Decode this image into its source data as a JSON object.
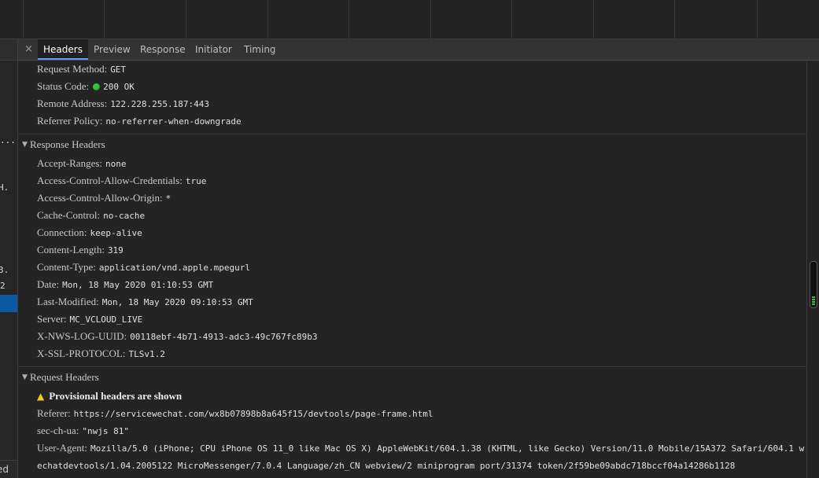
{
  "tabs": [
    {
      "label": "Headers",
      "active": true
    },
    {
      "label": "Preview",
      "active": false
    },
    {
      "label": "Response",
      "active": false
    },
    {
      "label": "Initiator",
      "active": false
    },
    {
      "label": "Timing",
      "active": false
    }
  ],
  "close_glyph": "×",
  "general": {
    "request_method": {
      "key": "Request Method:",
      "value": "GET"
    },
    "status_code": {
      "key": "Status Code:",
      "value": "200 OK",
      "status_color": "#38c43c"
    },
    "remote_address": {
      "key": "Remote Address:",
      "value": "122.228.255.187:443"
    },
    "referrer_policy": {
      "key": "Referrer Policy:",
      "value": "no-referrer-when-downgrade"
    }
  },
  "response_headers": {
    "title": "Response Headers",
    "items": [
      {
        "key": "Accept-Ranges:",
        "value": "none"
      },
      {
        "key": "Access-Control-Allow-Credentials:",
        "value": "true"
      },
      {
        "key": "Access-Control-Allow-Origin:",
        "value": "*"
      },
      {
        "key": "Cache-Control:",
        "value": "no-cache"
      },
      {
        "key": "Connection:",
        "value": "keep-alive"
      },
      {
        "key": "Content-Length:",
        "value": "319"
      },
      {
        "key": "Content-Type:",
        "value": "application/vnd.apple.mpegurl"
      },
      {
        "key": "Date:",
        "value": "Mon, 18 May 2020 01:10:53 GMT"
      },
      {
        "key": "Last-Modified:",
        "value": "Mon, 18 May 2020 09:10:53 GMT"
      },
      {
        "key": "Server:",
        "value": "MC_VCLOUD_LIVE"
      },
      {
        "key": "X-NWS-LOG-UUID:",
        "value": "00118ebf-4b71-4913-adc3-49c767fc89b3"
      },
      {
        "key": "X-SSL-PROTOCOL:",
        "value": "TLSv1.2"
      }
    ]
  },
  "request_headers": {
    "title": "Request Headers",
    "warning": "Provisional headers are shown",
    "items": [
      {
        "key": "Referer:",
        "value": "https://servicewechat.com/wx8b07898b8a645f15/devtools/page-frame.html"
      },
      {
        "key": "sec-ch-ua:",
        "value": "\"nwjs 81\""
      },
      {
        "key": "User-Agent:",
        "value": "Mozilla/5.0 (iPhone; CPU iPhone OS 11_0 like Mac OS X) AppleWebKit/604.1.38 (KHTML, like Gecko) Version/11.0 Mobile/15A372 Safari/604.1 w"
      }
    ],
    "ua_continuation": "echatdevtools/1.04.2005122 MicroMessenger/7.0.4 Language/zh_CN webview/2 miniprogram port/31374 token/2f59be09abdc718bccf04a14286b1128"
  },
  "left_fragments": [
    "...",
    "H.",
    "3.",
    "2"
  ],
  "left_footer": "ed"
}
